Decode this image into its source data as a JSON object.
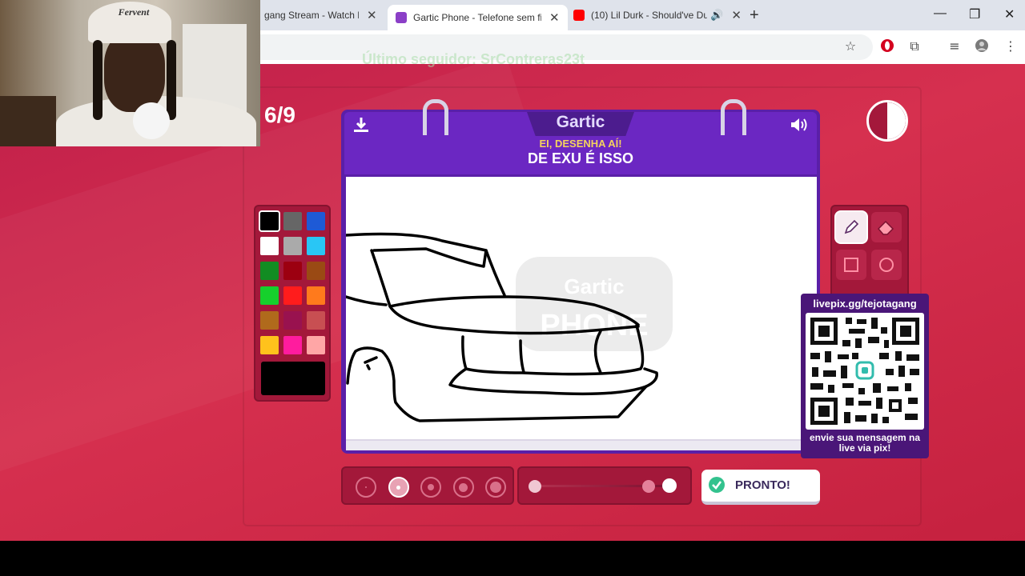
{
  "browser": {
    "tabs": [
      {
        "title": "gang Stream - Watch Live",
        "active": false
      },
      {
        "title": "Gartic Phone - Telefone sem fio",
        "active": true
      },
      {
        "title": "(10) Lil Durk - Should've Du",
        "active": false
      }
    ],
    "new_tab": "+",
    "window_controls": {
      "minimize": "—",
      "restore": "❐",
      "close": "✕"
    }
  },
  "overlay": {
    "follower_text": "Último seguidor: SrContreras23t",
    "webcam_cap_text": "Fervent"
  },
  "game": {
    "round": "6/9",
    "logo": "Gartic",
    "prompt_label": "EI, DESENHA AÍ!",
    "prompt_text": "DE EXU É ISSO",
    "watermark_top": "Gartic",
    "watermark_bottom": "PHONE",
    "done_button": "PRONTO!",
    "colors": {
      "background": "#d22a4d",
      "board": "#5a1fa8",
      "board_header": "#6b27c2",
      "prompt_label": "#f4d35e",
      "panel": "#a3183a",
      "current_color": "#000000"
    },
    "palette": [
      "#000000",
      "#666666",
      "#1e5ad6",
      "#ffffff",
      "#aaaaaa",
      "#29c6f5",
      "#128c22",
      "#9c0010",
      "#9a4a14",
      "#16d02c",
      "#ff1c1c",
      "#ff7a1c",
      "#b06a1c",
      "#99124f",
      "#c84f52",
      "#ffc21c",
      "#ff1c9e",
      "#ffa6a6"
    ],
    "selected_color_index": 0,
    "tools": [
      "pencil-icon",
      "eraser-icon",
      "square-icon",
      "circle-icon"
    ],
    "selected_tool": "pencil-icon",
    "brush_sizes_count": 5,
    "selected_brush_size_index": 1,
    "opacity_level": 1.0
  },
  "qr_overlay": {
    "title": "livepix.gg/tejotagang",
    "caption_line1": "envie sua mensagem na",
    "caption_line2": "live via pix!"
  }
}
